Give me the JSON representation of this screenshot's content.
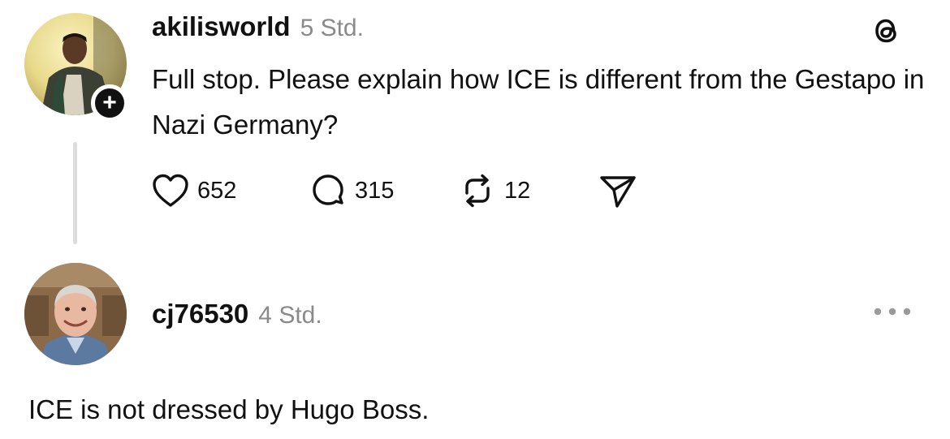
{
  "post": {
    "username": "akilisworld",
    "time": "5 Std.",
    "text": "Full stop. Please explain how ICE is different from the Gestapo in Nazi Germany?",
    "likes": "652",
    "replies": "315",
    "reposts": "12"
  },
  "reply": {
    "username": "cj76530",
    "time": "4 Std.",
    "text": "ICE is not dressed by Hugo Boss."
  },
  "icons": {
    "follow": "plus-icon",
    "app_logo": "threads-logo-icon",
    "like": "heart-icon",
    "reply": "comment-icon",
    "repost": "repost-icon",
    "share": "send-icon",
    "more": "more-dots-icon"
  }
}
